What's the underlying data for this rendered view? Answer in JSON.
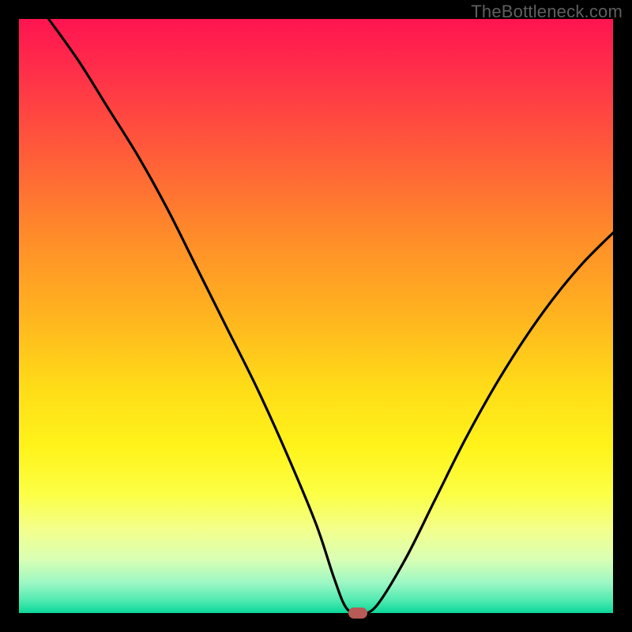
{
  "watermark": "TheBottleneck.com",
  "chart_data": {
    "type": "line",
    "title": "",
    "xlabel": "",
    "ylabel": "",
    "xlim": [
      0,
      100
    ],
    "ylim": [
      0,
      100
    ],
    "grid": false,
    "legend": false,
    "series": [
      {
        "name": "bottleneck-curve",
        "x": [
          5,
          10,
          15,
          20,
          25,
          30,
          35,
          40,
          45,
          50,
          53,
          55,
          57,
          60,
          65,
          70,
          75,
          80,
          85,
          90,
          95,
          100
        ],
        "values": [
          100,
          93,
          85,
          77,
          68,
          58,
          48,
          38,
          27,
          15,
          6,
          1,
          0,
          1,
          9,
          19,
          29,
          38,
          46,
          53,
          59,
          64
        ]
      }
    ],
    "marker": {
      "x": 57,
      "y": 0,
      "color": "#b85a56"
    },
    "background_gradient": {
      "top": "#ff1450",
      "mid": "#ffe81a",
      "bottom": "#0ad89a"
    }
  }
}
